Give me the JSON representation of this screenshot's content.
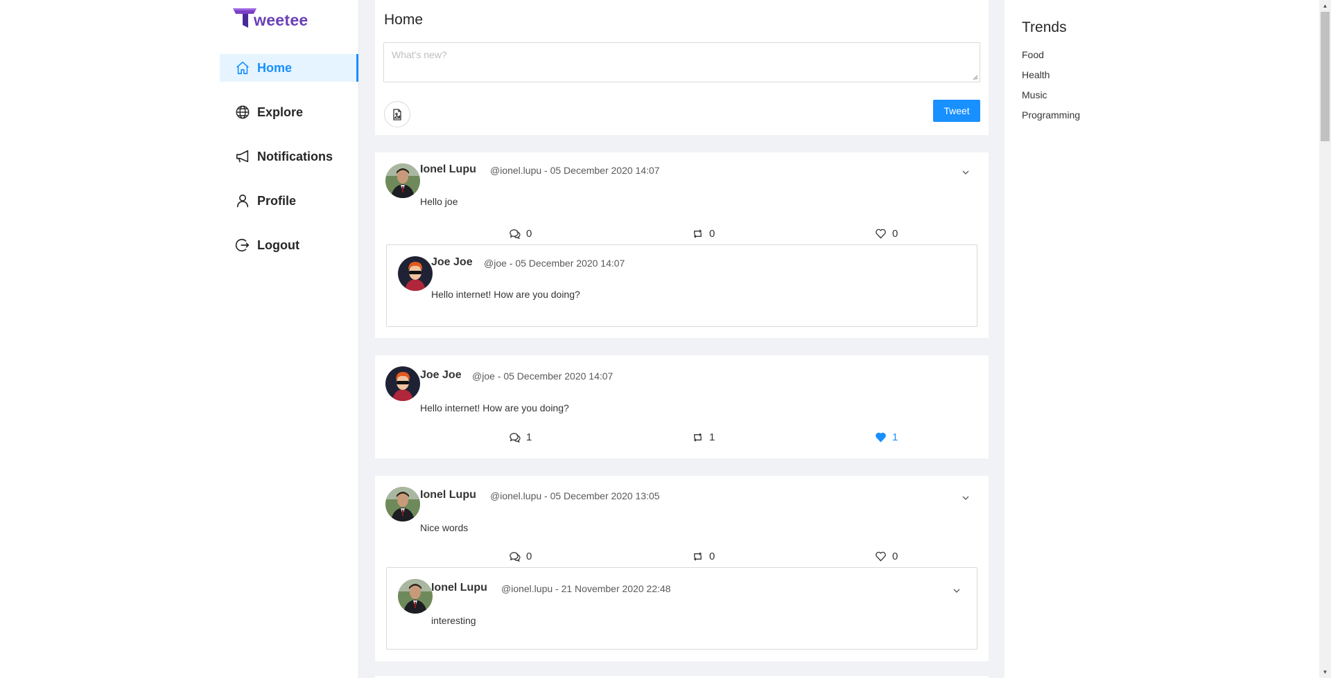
{
  "brand": {
    "name": "weetee"
  },
  "nav": [
    {
      "label": "Home",
      "icon": "home-icon",
      "active": true
    },
    {
      "label": "Explore",
      "icon": "globe-icon",
      "active": false
    },
    {
      "label": "Notifications",
      "icon": "megaphone-icon",
      "active": false
    },
    {
      "label": "Profile",
      "icon": "user-icon",
      "active": false
    },
    {
      "label": "Logout",
      "icon": "logout-icon",
      "active": false
    }
  ],
  "home": {
    "title": "Home",
    "compose_placeholder": "What's new?",
    "tweet_label": "Tweet"
  },
  "posts": [
    {
      "author": "Ionel Lupu",
      "meta": "@ionel.lupu - 05 December 2020 14:07",
      "text": "Hello joe",
      "comments": "0",
      "retweets": "0",
      "likes": "0",
      "quote": {
        "author": "Joe Joe",
        "meta": "@joe - 05 December 2020 14:07",
        "text": "Hello internet! How are you doing?"
      }
    },
    {
      "author": "Joe Joe",
      "meta": "@joe - 05 December 2020 14:07",
      "text": "Hello internet! How are you doing?",
      "comments": "1",
      "retweets": "1",
      "likes": "1",
      "liked": true
    },
    {
      "author": "Ionel Lupu",
      "meta": "@ionel.lupu - 05 December 2020 13:05",
      "text": "Nice words",
      "comments": "0",
      "retweets": "0",
      "likes": "0",
      "quote": {
        "author": "Ionel Lupu",
        "meta": "@ionel.lupu - 21 November 2020 22:48",
        "text": "interesting"
      }
    }
  ],
  "trends": {
    "title": "Trends",
    "items": [
      "Food",
      "Health",
      "Music",
      "Programming"
    ]
  },
  "colors": {
    "accent": "#1890ff",
    "brand": "#6a3fb8",
    "background": "#f0f2f5"
  }
}
